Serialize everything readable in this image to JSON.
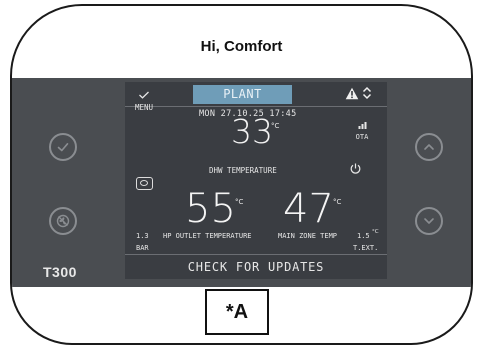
{
  "header": {
    "greeting": "Hi, Comfort"
  },
  "device": {
    "model": "T300"
  },
  "screen": {
    "menu_label": "MENU",
    "tab_label": "PLANT",
    "datetime": "MON 27.10.25 17:45",
    "ota_label": "OTA",
    "dhw_value": "33",
    "dhw_unit": "°C",
    "dhw_label": "DHW TEMPERATURE",
    "hp_outlet_value": "55",
    "hp_outlet_unit": "°C",
    "main_zone_value": "47",
    "main_zone_unit": "°C",
    "pressure_value": "1.3",
    "pressure_unit": "BAR",
    "hp_outlet_label": "HP OUTLET TEMPERATURE",
    "main_zone_label": "MAIN ZONE TEMP",
    "ext_temp_value": "1.5",
    "ext_temp_unit": "°C",
    "ext_temp_label": "T.EXT.",
    "check_updates": "CHECK FOR UPDATES"
  },
  "annotation": {
    "label": "*A"
  },
  "icons": [
    "check-icon",
    "fan-off-icon",
    "up-arrow-icon",
    "down-arrow-icon",
    "menu-check-icon",
    "warning-icon",
    "up-down-icon",
    "signal-icon",
    "power-icon",
    "tank-icon"
  ],
  "colors": {
    "band": "#4a4d51",
    "screen": "#3a3d42",
    "tab": "#6f9db8"
  }
}
